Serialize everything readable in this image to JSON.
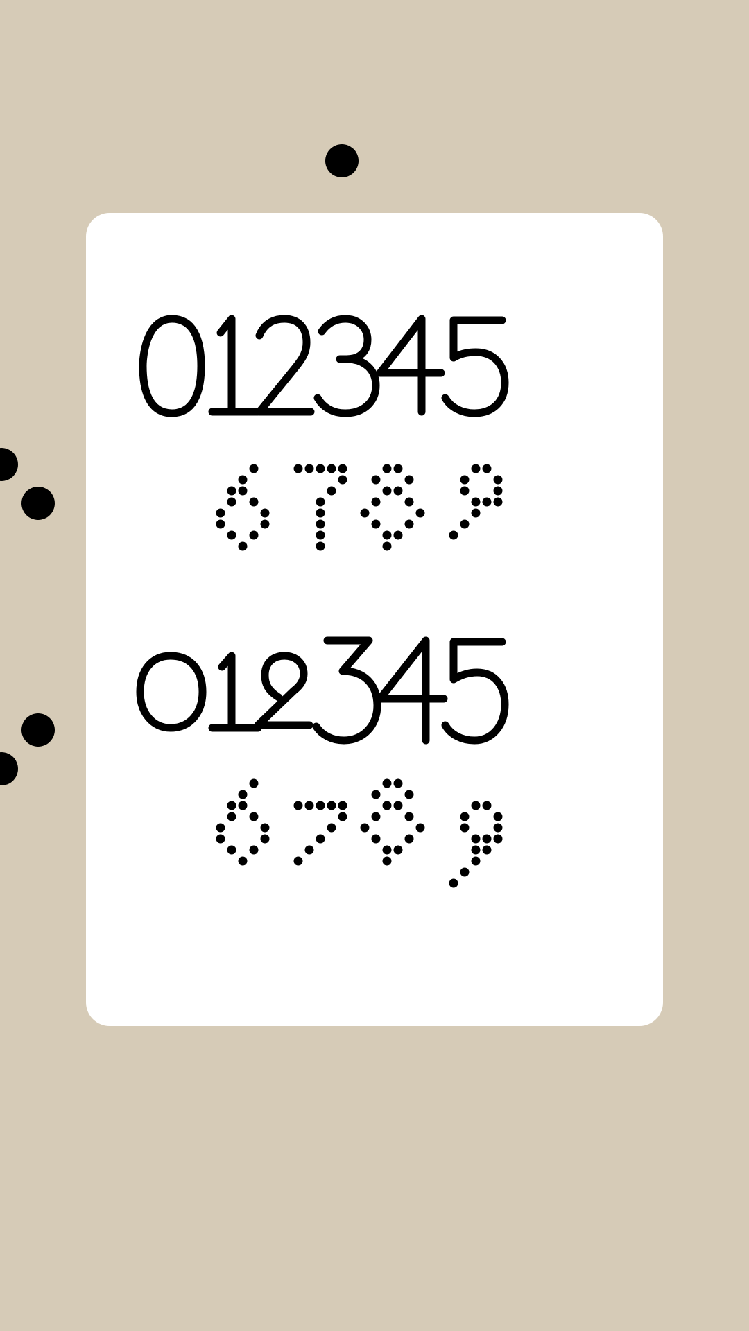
{
  "background_color": "#d6cbb7",
  "card_color": "#ffffff",
  "ink_color": "#000000",
  "specimens": [
    {
      "style": "outline",
      "variant": "lining",
      "text": "012345"
    },
    {
      "style": "dotted",
      "variant": "lining",
      "text": "6789"
    },
    {
      "style": "outline",
      "variant": "oldstyle",
      "text": "012345"
    },
    {
      "style": "dotted",
      "variant": "oldstyle",
      "text": "6789"
    }
  ]
}
